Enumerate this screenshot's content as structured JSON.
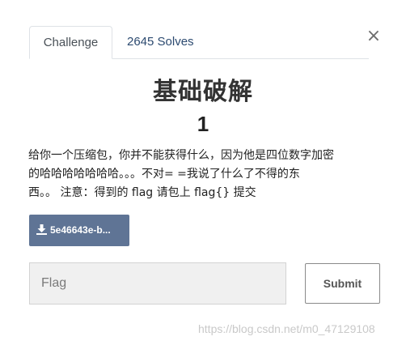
{
  "modal": {
    "close_glyph": "×",
    "tabs": [
      {
        "label": "Challenge",
        "active": true
      },
      {
        "label": "2645 Solves",
        "active": false
      }
    ],
    "challenge": {
      "name": "基础破解",
      "value": "1",
      "description_lines": [
        "给你一个压缩包，你并不能获得什么，因为他是四位数字加密",
        "的哈哈哈哈哈哈哈。。。不对= =我说了什么了不得的东",
        "西。。 注意：得到的 flag 请包上 flag{} 提交"
      ],
      "file_label": "5e46643e-b..."
    },
    "flag_form": {
      "placeholder": "Flag",
      "value": "",
      "submit_label": "Submit"
    }
  },
  "watermark": "https://blog.csdn.net/m0_47129108",
  "colors": {
    "download_bg": "#5f7495",
    "tab_inactive": "#2c4a70"
  },
  "icons": {
    "download": "download-icon",
    "close": "close-icon"
  }
}
